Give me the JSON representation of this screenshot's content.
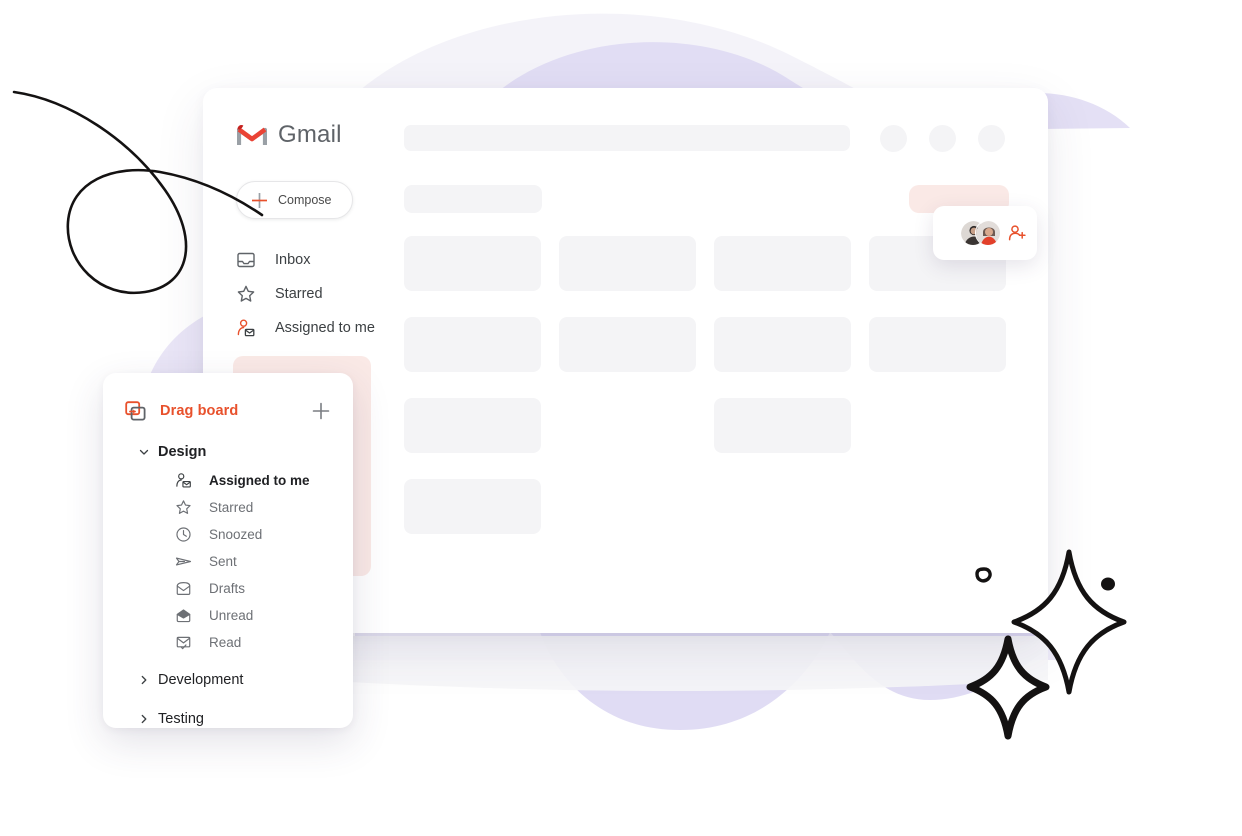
{
  "app": {
    "brand_name": "Gmail",
    "brand_icon": "gmail-m-logo-icon"
  },
  "compose": {
    "label": "Compose",
    "icon": "plus-icon"
  },
  "sidebar": {
    "items": [
      {
        "label": "Inbox",
        "icon": "inbox-icon"
      },
      {
        "label": "Starred",
        "icon": "star-icon"
      },
      {
        "label": "Assigned to me",
        "icon": "person-envelope-icon"
      }
    ]
  },
  "collaborators": {
    "avatars": [
      {
        "name": "collaborator-avatar-1"
      },
      {
        "name": "collaborator-avatar-2"
      }
    ],
    "add_icon": "add-person-icon"
  },
  "drag_board": {
    "title": "Drag board",
    "title_icon": "drag-board-copy-icon",
    "add_icon": "plus-icon",
    "groups": [
      {
        "name": "Design",
        "expanded": true,
        "caret": "chevron-down-icon",
        "active": true,
        "items": [
          {
            "label": "Assigned to me",
            "icon": "person-envelope-icon",
            "active": true
          },
          {
            "label": "Starred",
            "icon": "star-icon",
            "active": false
          },
          {
            "label": "Snoozed",
            "icon": "clock-icon",
            "active": false
          },
          {
            "label": "Sent",
            "icon": "send-icon",
            "active": false
          },
          {
            "label": "Drafts",
            "icon": "draft-envelope-icon",
            "active": false
          },
          {
            "label": "Unread",
            "icon": "unread-envelope-icon",
            "active": false
          },
          {
            "label": "Read",
            "icon": "read-envelope-check-icon",
            "active": false
          }
        ]
      },
      {
        "name": "Development",
        "expanded": false,
        "caret": "chevron-right-icon",
        "active": false,
        "items": []
      },
      {
        "name": "Testing",
        "expanded": false,
        "caret": "chevron-right-icon",
        "active": false,
        "items": []
      }
    ]
  },
  "colors": {
    "brand_red": "#e8512c",
    "gmail_red": "#ea4335",
    "skeleton_gray": "#f4f4f6",
    "drop_pink": "#fae9e6",
    "blob_lavender": "#d9d4f2",
    "text_primary": "#202124",
    "text_muted": "#6d7075"
  },
  "decorations": {
    "swirl": "hand-drawn-swirl-line",
    "sparkle_large": "hand-drawn-sparkle-icon",
    "sparkle_small": "hand-drawn-sparkle-icon",
    "dot_outline": "hand-drawn-circle-outline",
    "dot_filled": "hand-drawn-filled-dot"
  }
}
